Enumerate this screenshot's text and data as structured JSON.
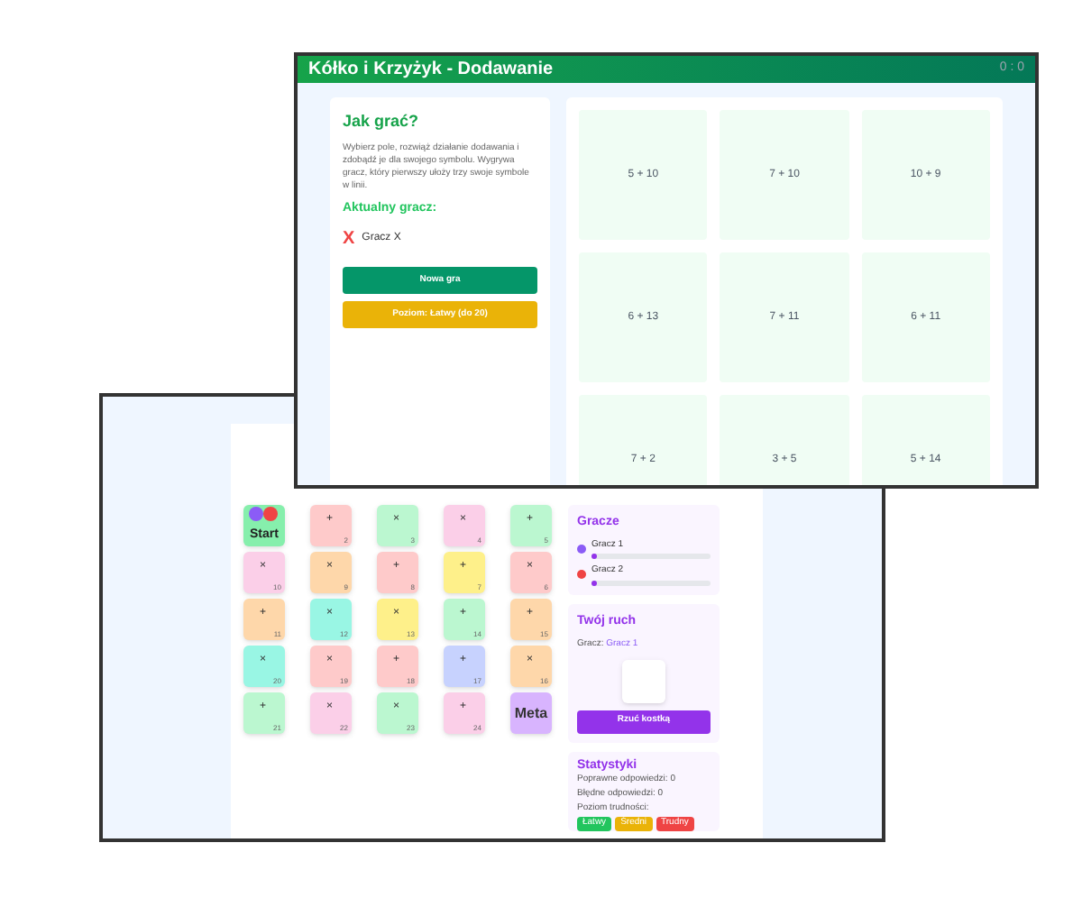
{
  "front_window": {
    "title": "Kółko i Krzyżyk - Dodawanie",
    "score": "0 : 0",
    "how_to": {
      "heading": "Jak grać?",
      "text": "Wybierz pole, rozwiąż działanie dodawania i zdobądź je dla swojego symbolu. Wygrywa gracz, który pierwszy ułoży trzy swoje symbole w linii.",
      "current_label": "Aktualny gracz:",
      "current_symbol": "X",
      "current_player": "Gracz X"
    },
    "buttons": [
      {
        "label": "Nowa gra",
        "kind": "primary"
      },
      {
        "label": "Poziom: Łatwy (do 20)",
        "kind": "level"
      }
    ],
    "cells": [
      {
        "text": "5 + 10"
      },
      {
        "text": "7 + 10"
      },
      {
        "text": "10 + 9"
      },
      {
        "text": "6 + 13"
      },
      {
        "text": "7 + 11"
      },
      {
        "text": "6 + 11"
      },
      {
        "text": "7 + 2"
      },
      {
        "text": "3 + 5"
      },
      {
        "text": "5 + 14"
      }
    ]
  },
  "back_window": {
    "board": [
      {
        "kind": "start",
        "label": "Start",
        "color": "#86efac"
      },
      {
        "kind": "field",
        "op": "+",
        "number": "2",
        "color": "#fecaca"
      },
      {
        "kind": "field",
        "op": "×",
        "number": "3",
        "color": "#bbf7d0"
      },
      {
        "kind": "field",
        "op": "×",
        "number": "4",
        "color": "#fbcfe8"
      },
      {
        "kind": "field",
        "op": "+",
        "number": "5",
        "color": "#bbf7d0"
      },
      {
        "kind": "field",
        "op": "×",
        "number": "10",
        "color": "#fbcfe8"
      },
      {
        "kind": "field",
        "op": "×",
        "number": "9",
        "color": "#fed7aa"
      },
      {
        "kind": "field",
        "op": "+",
        "number": "8",
        "color": "#fecaca"
      },
      {
        "kind": "field",
        "op": "+",
        "number": "7",
        "color": "#fef08a"
      },
      {
        "kind": "field",
        "op": "×",
        "number": "6",
        "color": "#fecaca"
      },
      {
        "kind": "field",
        "op": "+",
        "number": "11",
        "color": "#fed7aa"
      },
      {
        "kind": "field",
        "op": "×",
        "number": "12",
        "color": "#99f6e4"
      },
      {
        "kind": "field",
        "op": "×",
        "number": "13",
        "color": "#fef08a"
      },
      {
        "kind": "field",
        "op": "+",
        "number": "14",
        "color": "#bbf7d0"
      },
      {
        "kind": "field",
        "op": "+",
        "number": "15",
        "color": "#fed7aa"
      },
      {
        "kind": "field",
        "op": "×",
        "number": "20",
        "color": "#99f6e4"
      },
      {
        "kind": "field",
        "op": "×",
        "number": "19",
        "color": "#fecaca"
      },
      {
        "kind": "field",
        "op": "+",
        "number": "18",
        "color": "#fecaca"
      },
      {
        "kind": "field",
        "op": "+",
        "number": "17",
        "color": "#c7d2fe"
      },
      {
        "kind": "field",
        "op": "×",
        "number": "16",
        "color": "#fed7aa"
      },
      {
        "kind": "field",
        "op": "+",
        "number": "21",
        "color": "#bbf7d0"
      },
      {
        "kind": "field",
        "op": "×",
        "number": "22",
        "color": "#fbcfe8"
      },
      {
        "kind": "field",
        "op": "×",
        "number": "23",
        "color": "#bbf7d0"
      },
      {
        "kind": "field",
        "op": "+",
        "number": "24",
        "color": "#fbcfe8"
      },
      {
        "kind": "meta",
        "label": "Meta",
        "color": "#d8b4fe"
      }
    ],
    "players_heading": "Gracze",
    "players": [
      {
        "name": "Gracz 1",
        "color": "#8b5cf6",
        "level": 0.04
      },
      {
        "name": "Gracz 2",
        "color": "#ef4444",
        "level": 0.04
      }
    ],
    "turn": {
      "heading": "Twój ruch",
      "label": "Gracz:",
      "player": "Gracz 1",
      "button": "Rzuć kostką"
    },
    "stats": {
      "heading": "Statystyki",
      "correct": "Poprawne odpowiedzi: 0",
      "wrong": "Błędne odpowiedzi: 0",
      "difficulty_label": "Poziom trudności:",
      "levels": [
        {
          "label": "Łatwy",
          "color": "#22c55e"
        },
        {
          "label": "Średni",
          "color": "#eab308"
        },
        {
          "label": "Trudny",
          "color": "#ef4444"
        }
      ]
    }
  }
}
